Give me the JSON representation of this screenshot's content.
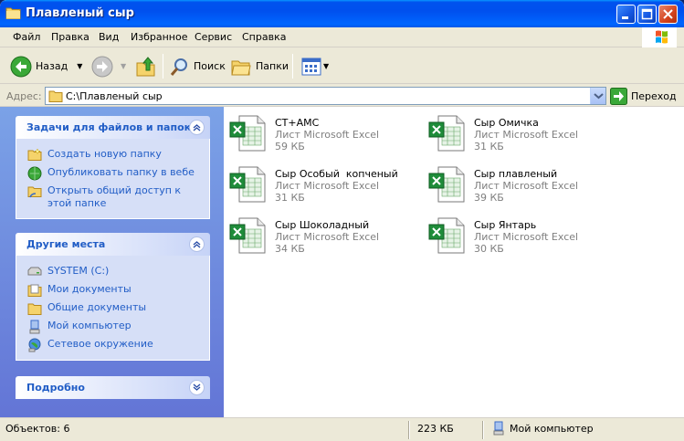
{
  "window": {
    "title": "Плавленый сыр",
    "accent": "#0053ee"
  },
  "menu": {
    "items": [
      "Файл",
      "Правка",
      "Вид",
      "Избранное",
      "Сервис",
      "Справка"
    ]
  },
  "toolbar": {
    "back_label": "Назад",
    "search_label": "Поиск",
    "folders_label": "Папки"
  },
  "address": {
    "label": "Адрес:",
    "value": "C:\\Плавленый сыр",
    "go_label": "Переход"
  },
  "tasks_panel": {
    "title": "Задачи для файлов и папок",
    "items": [
      {
        "label": "Создать новую папку",
        "icon": "new-folder-icon"
      },
      {
        "label": "Опубликовать папку в вебе",
        "icon": "publish-web-icon"
      },
      {
        "label": "Открыть общий доступ к этой папке",
        "icon": "share-folder-icon"
      }
    ]
  },
  "places_panel": {
    "title": "Другие места",
    "items": [
      {
        "label": "SYSTEM (C:)",
        "icon": "drive-icon"
      },
      {
        "label": "Мои документы",
        "icon": "my-documents-icon"
      },
      {
        "label": "Общие документы",
        "icon": "shared-documents-icon"
      },
      {
        "label": "Мой компьютер",
        "icon": "my-computer-icon"
      },
      {
        "label": "Сетевое окружение",
        "icon": "network-icon"
      }
    ]
  },
  "details_panel": {
    "title": "Подробно"
  },
  "files": [
    {
      "name": "СТ+АМС",
      "type": "Лист Microsoft Excel",
      "size": "59 КБ"
    },
    {
      "name": "Сыр Омичка",
      "type": "Лист Microsoft Excel",
      "size": "31 КБ"
    },
    {
      "name": "Сыр Особый  копченый",
      "type": "Лист Microsoft Excel",
      "size": "31 КБ"
    },
    {
      "name": "Сыр плавленый",
      "type": "Лист Microsoft Excel",
      "size": "39 КБ"
    },
    {
      "name": "Сыр Шоколадный",
      "type": "Лист Microsoft Excel",
      "size": "34 КБ"
    },
    {
      "name": "Сыр Янтарь",
      "type": "Лист Microsoft Excel",
      "size": "30 КБ"
    }
  ],
  "status": {
    "objects": "Объектов: 6",
    "size": "223 КБ",
    "location": "Мой компьютер"
  }
}
